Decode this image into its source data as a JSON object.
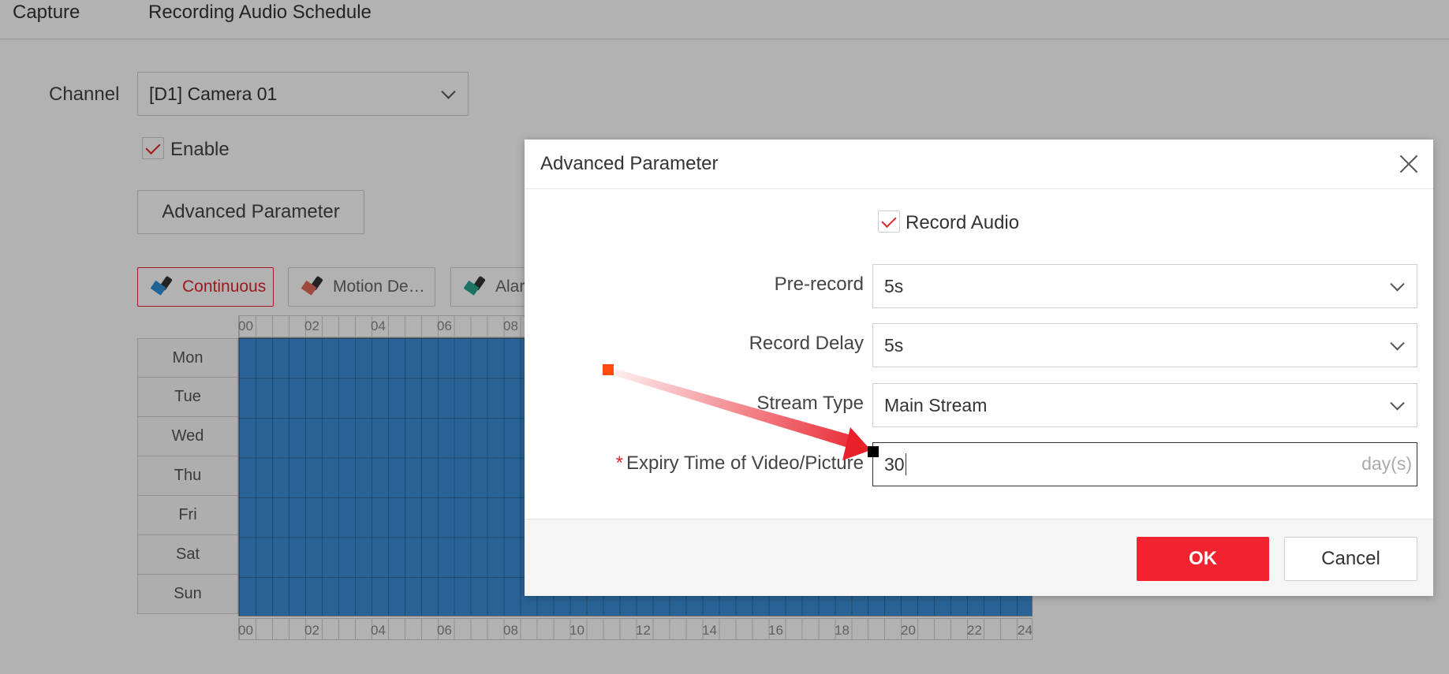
{
  "tabs": [
    "Capture",
    "Recording Audio Schedule"
  ],
  "channel": {
    "label": "Channel",
    "value": "[D1] Camera 01"
  },
  "enable": {
    "label": "Enable",
    "checked": true
  },
  "advanced_button": "Advanced Parameter",
  "tools": [
    {
      "label": "Continuous",
      "color": "#2f8fd8",
      "active": true
    },
    {
      "label": "Motion De…",
      "color": "#e26a5a",
      "active": false
    },
    {
      "label": "Alar",
      "color": "#2aa58f",
      "active": false
    }
  ],
  "schedule": {
    "top_hours_visible": [
      "00",
      "02",
      "04",
      "06",
      "08"
    ],
    "bottom_hours": [
      "00",
      "02",
      "04",
      "06",
      "08",
      "10",
      "12",
      "14",
      "16",
      "18",
      "20",
      "22",
      "24"
    ],
    "days": [
      "Mon",
      "Tue",
      "Wed",
      "Thu",
      "Fri",
      "Sat",
      "Sun"
    ],
    "fill_color": "#3c8ed6"
  },
  "dialog": {
    "title": "Advanced Parameter",
    "record_audio": {
      "label": "Record Audio",
      "checked": true
    },
    "pre_record": {
      "label": "Pre-record",
      "value": "5s"
    },
    "record_delay": {
      "label": "Record Delay",
      "value": "5s"
    },
    "stream_type": {
      "label": "Stream Type",
      "value": "Main Stream"
    },
    "expiry": {
      "required_mark": "*",
      "label": "Expiry Time of Video/Picture",
      "value": "30",
      "unit": "day(s)"
    },
    "ok": "OK",
    "cancel": "Cancel"
  },
  "colors": {
    "accent": "#e4232c",
    "ok_button": "#f0232e",
    "annotation_arrow": "#e8202a"
  }
}
